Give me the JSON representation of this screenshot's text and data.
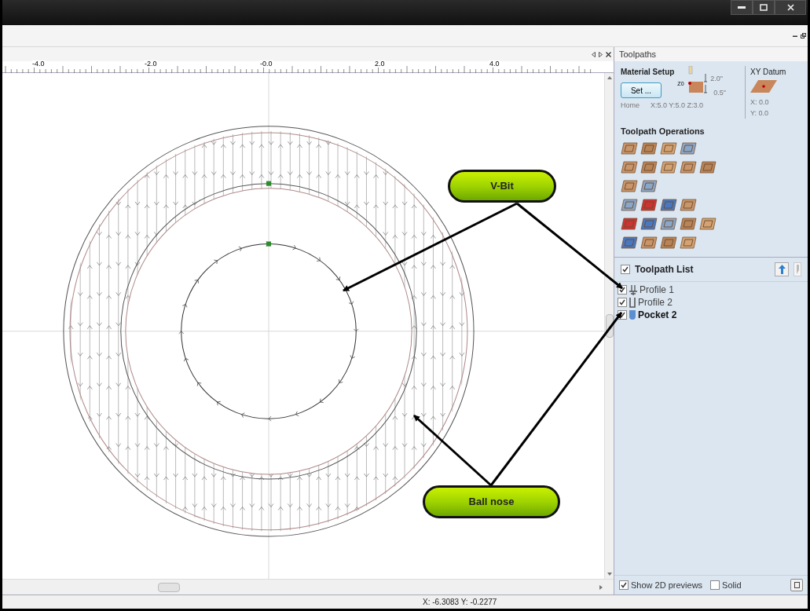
{
  "document": {
    "ruler_labels": [
      "-4.0",
      "-2.0",
      "-0.0",
      "2.0",
      "4.0"
    ]
  },
  "panel": {
    "title": "Toolpaths",
    "material_setup": {
      "title": "Material Setup",
      "button": "Set ...",
      "z_label": "Z0",
      "thickness": "2.0\"",
      "offset": "0.5\"",
      "home_label": "Home",
      "home_value": "X:5.0 Y:5.0 Z:3.0"
    },
    "datum": {
      "title": "XY Datum",
      "x": "X: 0.0",
      "y": "Y: 0.0"
    },
    "operations_title": "Toolpath Operations",
    "list": {
      "title": "Toolpath List",
      "checked": true,
      "items": [
        {
          "label": "Profile 1",
          "kind": "vbit",
          "checked": true,
          "selected": false
        },
        {
          "label": "Profile 2",
          "kind": "endmill",
          "checked": true,
          "selected": false
        },
        {
          "label": "Pocket 2",
          "kind": "ballnose",
          "checked": true,
          "selected": true
        }
      ]
    },
    "footer": [
      {
        "label": "Show 2D previews",
        "checked": true
      },
      {
        "label": "Solid",
        "checked": false
      }
    ]
  },
  "callouts": [
    {
      "label": "V-Bit"
    },
    {
      "label": "Ball nose"
    }
  ],
  "status_bar": {
    "coordinates": "X: -6.3083 Y: -0.2277"
  }
}
